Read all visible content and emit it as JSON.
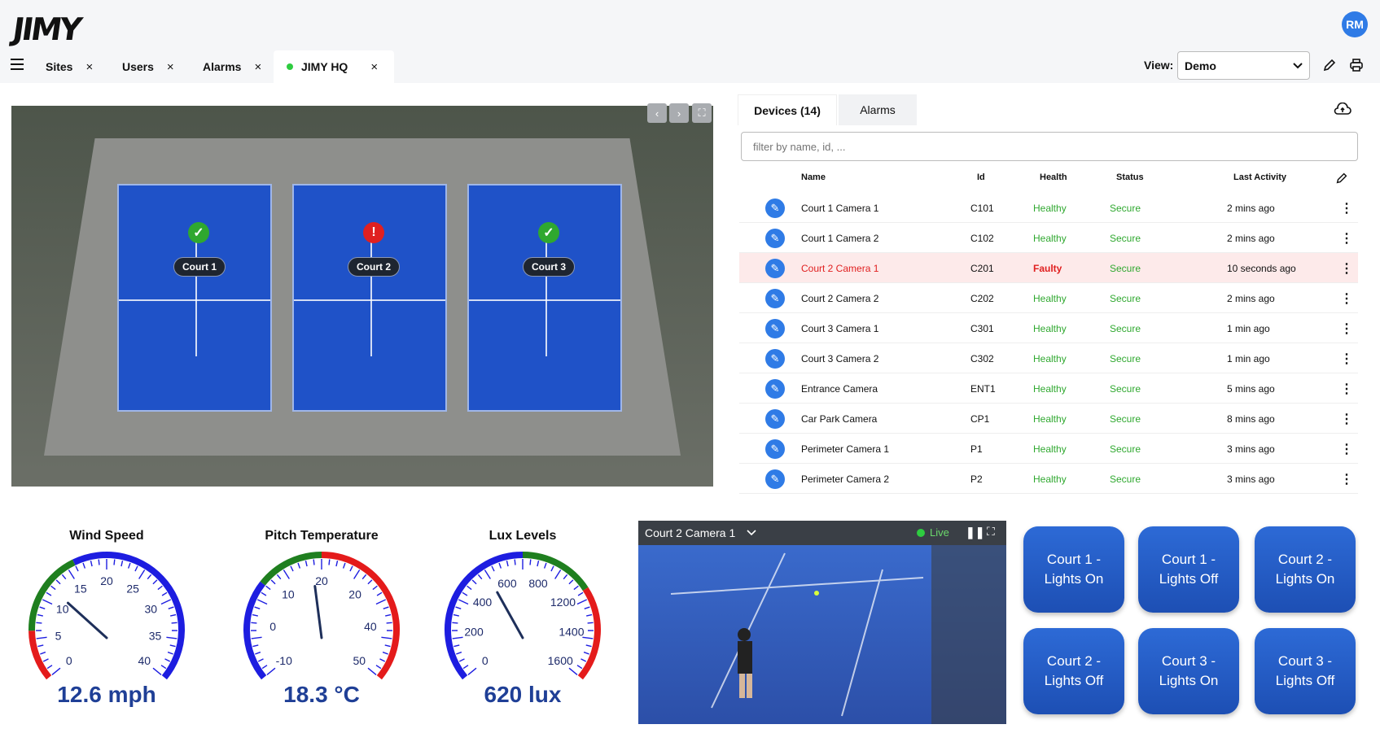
{
  "app": {
    "logo": "JIMY",
    "user_initials": "RM"
  },
  "tabs": [
    {
      "label": "Sites",
      "close": "×"
    },
    {
      "label": "Users",
      "close": "×"
    },
    {
      "label": "Alarms",
      "close": "×"
    },
    {
      "label": "JIMY HQ",
      "close": "×"
    }
  ],
  "view": {
    "label": "View:",
    "selected": "Demo"
  },
  "map": {
    "courts": [
      {
        "label": "Court 1",
        "status": "ok"
      },
      {
        "label": "Court 2",
        "status": "alert"
      },
      {
        "label": "Court 3",
        "status": "ok"
      }
    ]
  },
  "devices_panel": {
    "tabs": [
      "Devices (14)",
      "Alarms"
    ],
    "filter_placeholder": "filter by name, id, ...",
    "columns": [
      "Name",
      "Id",
      "Health",
      "Status",
      "Last Activity"
    ],
    "rows": [
      {
        "name": "Court 1 Camera 1",
        "id": "C101",
        "health": "Healthy",
        "status": "Secure",
        "last": "2 mins ago"
      },
      {
        "name": "Court 1 Camera 2",
        "id": "C102",
        "health": "Healthy",
        "status": "Secure",
        "last": "2 mins ago"
      },
      {
        "name": "Court 2 Camera 1",
        "id": "C201",
        "health": "Faulty",
        "status": "Secure",
        "last": "10 seconds ago"
      },
      {
        "name": "Court 2 Camera 2",
        "id": "C202",
        "health": "Healthy",
        "status": "Secure",
        "last": "2 mins ago"
      },
      {
        "name": "Court 3 Camera 1",
        "id": "C301",
        "health": "Healthy",
        "status": "Secure",
        "last": "1 min ago"
      },
      {
        "name": "Court 3 Camera 2",
        "id": "C302",
        "health": "Healthy",
        "status": "Secure",
        "last": "1 min ago"
      },
      {
        "name": "Entrance Camera",
        "id": "ENT1",
        "health": "Healthy",
        "status": "Secure",
        "last": "5 mins ago"
      },
      {
        "name": "Car Park Camera",
        "id": "CP1",
        "health": "Healthy",
        "status": "Secure",
        "last": "8 mins ago"
      },
      {
        "name": "Perimeter Camera 1",
        "id": "P1",
        "health": "Healthy",
        "status": "Secure",
        "last": "3 mins ago"
      },
      {
        "name": "Perimeter Camera 2",
        "id": "P2",
        "health": "Healthy",
        "status": "Secure",
        "last": "3 mins ago"
      }
    ]
  },
  "gauges": [
    {
      "title": "Wind Speed",
      "value_text": "12.6 mph",
      "value": 12.6,
      "min": 0,
      "max": 40,
      "ticks": [
        "0",
        "5",
        "10",
        "15",
        "20",
        "25",
        "30",
        "35",
        "40"
      ]
    },
    {
      "title": "Pitch Temperature",
      "value_text": "18.3 °C",
      "value": 18.3,
      "min": -10,
      "max": 50,
      "ticks": [
        "-10",
        "0",
        "10",
        "20",
        "20",
        "40",
        "50"
      ]
    },
    {
      "title": "Lux Levels",
      "value_text": "620 lux",
      "value": 620,
      "min": 0,
      "max": 1600,
      "ticks": [
        "0",
        "200",
        "400",
        "600",
        "800",
        "1200",
        "1400",
        "1600"
      ]
    }
  ],
  "camera": {
    "title": "Court 2 Camera 1",
    "live": "Live"
  },
  "lights": [
    "Court 1 - Lights On",
    "Court 1 - Lights Off",
    "Court 2 - Lights On",
    "Court 2 - Lights Off",
    "Court 3 - Lights On",
    "Court 3 - Lights Off"
  ],
  "colors": {
    "accent": "#2f7be6",
    "healthy": "#2fa82f",
    "faulty": "#e02020",
    "gauge_value": "#1f3f96"
  }
}
